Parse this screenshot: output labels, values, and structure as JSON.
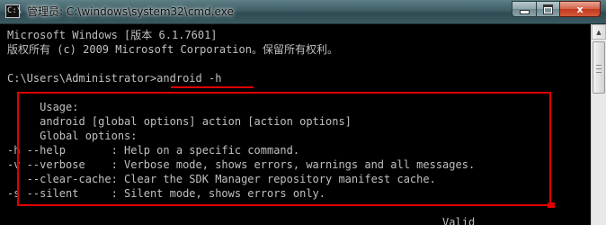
{
  "window": {
    "title": "管理员: C:\\windows\\system32\\cmd.exe",
    "icon": "cmd-icon",
    "icon_glyph": "C:\\",
    "buttons": {
      "minimize": "minimize-icon",
      "maximize": "maximize-icon",
      "close_label": "x"
    }
  },
  "console": {
    "lines": [
      "Microsoft Windows [版本 6.1.7601]",
      "版权所有 (c) 2009 Microsoft Corporation。保留所有权利。",
      "",
      "C:\\Users\\Administrator>android -h",
      "",
      "     Usage:",
      "     android [global options] action [action options]",
      "     Global options:",
      "-h --help       : Help on a specific command.",
      "-v --verbose    : Verbose mode, shows errors, warnings and all messages.",
      "   --clear-cache: Clear the SDK Manager repository manifest cache.",
      "-s --silent     : Silent mode, shows errors only.",
      "",
      "                                                                   Valid"
    ]
  },
  "annotations": {
    "highlight_color": "#e00000"
  },
  "scrollbar": {
    "up_arrow": "scroll-up-arrow-icon"
  }
}
